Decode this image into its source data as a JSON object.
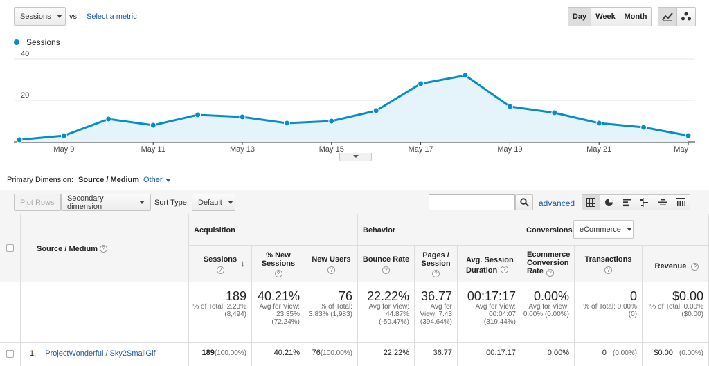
{
  "controls": {
    "metric": "Sessions",
    "vs": "vs.",
    "select_metric": "Select a metric",
    "day": "Day",
    "week": "Week",
    "month": "Month",
    "line_icon": "line-chart-icon",
    "motion_icon": "motion-chart-icon"
  },
  "legend": {
    "label": "Sessions",
    "color": "#058dc7"
  },
  "chart_data": {
    "type": "area",
    "x": [
      "May 8",
      "May 9",
      "May 10",
      "May 11",
      "May 12",
      "May 13",
      "May 14",
      "May 15",
      "May 16",
      "May 17",
      "May 18",
      "May 19",
      "May 20",
      "May 21",
      "May 22",
      "May 23"
    ],
    "series": [
      {
        "name": "Sessions",
        "values": [
          1,
          3,
          11,
          8,
          13,
          12,
          9,
          10,
          15,
          28,
          32,
          17,
          14,
          9,
          7,
          3
        ]
      }
    ],
    "ylim": [
      0,
      40
    ],
    "yticks": [
      "20",
      "40"
    ],
    "xtick_labels": [
      "May 9",
      "May 11",
      "May 13",
      "May 15",
      "May 17",
      "May 19",
      "May 21",
      "May"
    ],
    "line_color": "#058dc7",
    "fill_color": "#e5f3fa"
  },
  "dimension": {
    "label": "Primary Dimension:",
    "selected": "Source / Medium",
    "other": "Other"
  },
  "toolbar": {
    "plot_rows": "Plot Rows",
    "secondary_dimension": "Secondary dimension",
    "sort_type_label": "Sort Type:",
    "sort_default": "Default",
    "search_value": "",
    "advanced": "advanced"
  },
  "table": {
    "source_medium": "Source / Medium",
    "acquisition": "Acquisition",
    "behavior": "Behavior",
    "conversions": "Conversions",
    "ecommerce_select": "eCommerce",
    "columns": {
      "sessions": "Sessions",
      "new_sessions": "% New Sessions",
      "new_users": "New Users",
      "bounce_rate": "Bounce Rate",
      "pages_session": "Pages / Session",
      "avg_duration": "Avg. Session Duration",
      "conv_rate": "Ecommerce Conversion Rate",
      "transactions": "Transactions",
      "revenue": "Revenue"
    },
    "totals": {
      "sessions": "189",
      "sessions_sub": "% of Total: 2.23% (8,494)",
      "new_sessions": "40.21%",
      "new_sessions_sub": "Avg for View: 23.35% (72.24%)",
      "new_users": "76",
      "new_users_sub": "% of Total: 3.83% (1,983)",
      "bounce_rate": "22.22%",
      "bounce_rate_sub": "Avg for View: 44.87% (-50.47%)",
      "pages_session": "36.77",
      "pages_session_sub": "Avg for View: 7.43 (394.64%)",
      "avg_duration": "00:17:17",
      "avg_duration_sub": "Avg for View: 00:04:07 (319.44%)",
      "conv_rate": "0.00%",
      "conv_rate_sub": "Avg for View: 0.00% (0.00%)",
      "transactions": "0",
      "transactions_sub": "% of Total: 0.00% (0)",
      "revenue": "$0.00",
      "revenue_sub": "% of Total: 0.00% ($0.00)"
    },
    "rows": [
      {
        "index": "1.",
        "source": "ProjectWonderful / Sky2SmallGif",
        "sessions": "189",
        "sessions_pct": "(100.00%)",
        "new_sessions": "40.21%",
        "new_users": "76",
        "new_users_pct": "(100.00%)",
        "bounce_rate": "22.22%",
        "pages_session": "36.77",
        "avg_duration": "00:17:17",
        "conv_rate": "0.00%",
        "transactions": "0",
        "transactions_pct": "(0.00%)",
        "revenue": "$0.00",
        "revenue_pct": "(0.00%)"
      }
    ]
  }
}
